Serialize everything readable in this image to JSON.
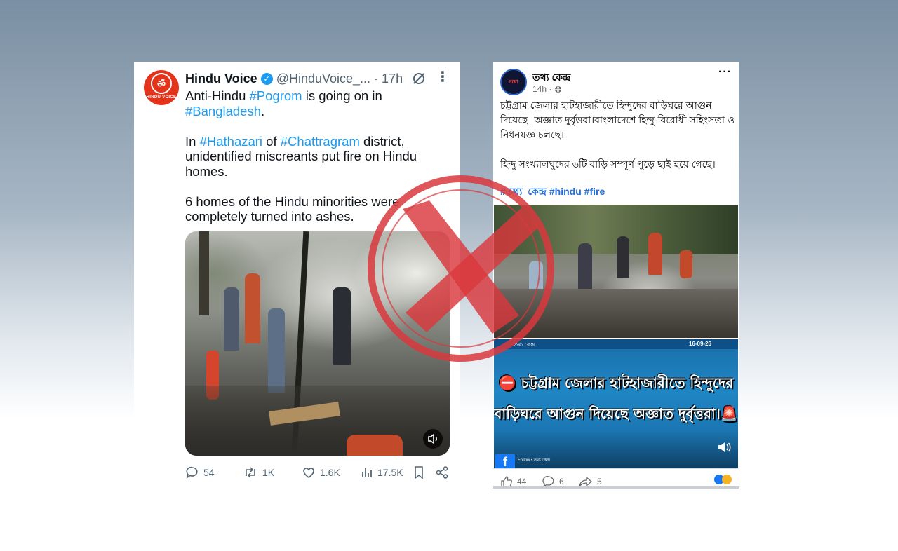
{
  "tweet": {
    "display_name": "Hindu Voice",
    "handle": "@HinduVoice_...",
    "sep": " · ",
    "time": "17h",
    "avatar_text": "HINDU VOICE",
    "avatar_glyph": "ॐ",
    "text": {
      "p1_a": "Anti-Hindu ",
      "p1_tag1": "#Pogrom",
      "p1_b": " is going on in",
      "p1_tag2": "#Bangladesh",
      "p1_c": ".",
      "p2_a": "In ",
      "p2_tag1": "#Hathazari",
      "p2_b": " of ",
      "p2_tag2": "#Chattragram",
      "p2_c": " district, unidentified miscreants put fire on Hindu homes.",
      "p3": "6 homes of the Hindu minorities were completely turned into ashes."
    },
    "actions": {
      "replies": "54",
      "retweets": "1K",
      "likes": "1.6K",
      "views": "17.5K"
    },
    "icons": [
      "grok-icon",
      "more-icon",
      "speaker-icon",
      "reply-icon",
      "retweet-icon",
      "like-icon",
      "views-icon",
      "bookmark-icon",
      "share-icon",
      "verified-icon"
    ]
  },
  "facebook": {
    "page_name": "তথ্য কেন্দ্র",
    "time": "14h",
    "time_sep": " · ",
    "avatar_text": "তথ্য",
    "more": "···",
    "text_p1": "চট্টগ্রাম জেলার হাটহাজারীতে হিন্দুদের বাড়িঘরে আগুন দিয়েছে। অজ্ঞাত দুর্বৃত্তরা।বাংলাদেশে হিন্দু-বিরোধী সহিংসতা ও নিধনযজ্ঞ চলছে।",
    "text_p2": "হিন্দু সংখ্যালঘুদের ৬টি বাড়ি সম্পূর্ণ পুড়ে ছাই হয়ে গেছে।",
    "hashtags": "#তথ্য_কেন্দ্র #hindu #fire",
    "video": {
      "date": "16-09-26",
      "source": "তথ্য কেন্দ্র",
      "overlay_line1": "⛔ চট্টগ্রাম জেলার হাটহাজারীতে হিন্দুদের",
      "overlay_line2": "বাড়িঘরে আগুন দিয়েছে অজ্ঞাত দুর্বৃত্তরা।🚨",
      "logo": "f",
      "follow": "Follow • তথ্য কেন্দ্র"
    },
    "actions": {
      "likes": "44",
      "comments": "6",
      "shares": "5"
    },
    "colors": {
      "link": "#216fdb",
      "like_blue": "#1877f2"
    }
  },
  "stamp": {
    "color": "#d9383d",
    "meaning": "false-claim-cross"
  }
}
